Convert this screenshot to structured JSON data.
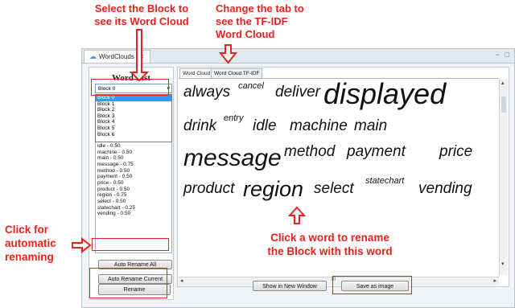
{
  "annotations": {
    "select_block": "Select the Block to see its Word Cloud",
    "change_tab": "Change the TF-IDF Word Cloud",
    "change_tab_line1": "Change the tab to",
    "change_tab_line2": "see the TF-IDF",
    "change_tab_line3": "Word Cloud",
    "click_auto_line1": "Click for",
    "click_auto_line2": "automatic",
    "click_auto_line3": "renaming",
    "click_word_line1": "Click a word to rename",
    "click_word_line2": "the Block with this word",
    "select_line1": "Select the Block to",
    "select_line2": "see its Word Cloud",
    "color": "#e8231d"
  },
  "window": {
    "tab_label": "WordClouds",
    "tab_close": "✕",
    "controls": "− □"
  },
  "left": {
    "title": "Word List",
    "combo_value": "Block 0",
    "combo_arrow": "▾",
    "dropdown": [
      "Block 0",
      "Block 1",
      "Block 2",
      "Block 3",
      "Block 4",
      "Block 5",
      "Block 6"
    ],
    "list": [
      "idle - 0.50",
      "machine - 0.50",
      "main - 0.50",
      "message - 0.75",
      "method - 0.50",
      "payment - 0.50",
      "price - 0.50",
      "product - 0.50",
      "region - 0.75",
      "select - 0.50",
      "statechart - 0.25",
      "vending - 0.50"
    ],
    "auto_rename_all": "Auto Rename All",
    "auto_rename_current": "Auto Rename Current",
    "rename": "Rename"
  },
  "right": {
    "tabs": [
      "Word Cloud",
      "Word Cloud TF-IDF"
    ],
    "show_window": "Show in New Window",
    "save_image": "Save as image",
    "scroll_label": "III"
  },
  "cloud_words": [
    {
      "text": "always",
      "size": 19
    },
    {
      "text": "cancel",
      "size": 11
    },
    {
      "text": "deliver",
      "size": 19
    },
    {
      "text": "displayed",
      "size": 36
    },
    {
      "text": "drink",
      "size": 19
    },
    {
      "text": "entry",
      "size": 11
    },
    {
      "text": "idle",
      "size": 19
    },
    {
      "text": "machine",
      "size": 19
    },
    {
      "text": "main",
      "size": 19
    },
    {
      "text": "message",
      "size": 30
    },
    {
      "text": "method",
      "size": 19
    },
    {
      "text": "payment",
      "size": 19
    },
    {
      "text": "price",
      "size": 19
    },
    {
      "text": "product",
      "size": 19
    },
    {
      "text": "region",
      "size": 27
    },
    {
      "text": "select",
      "size": 19
    },
    {
      "text": "statechart",
      "size": 11
    },
    {
      "text": "vending",
      "size": 19
    }
  ]
}
